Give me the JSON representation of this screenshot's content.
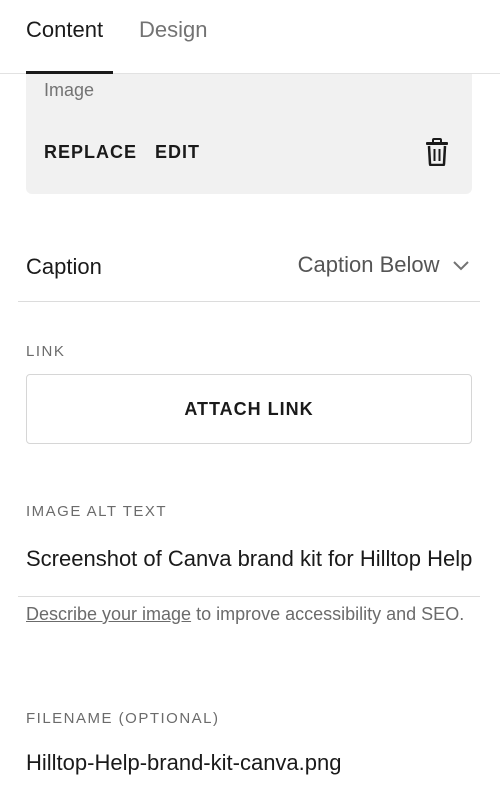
{
  "tabs": [
    {
      "label": "Content",
      "active": true
    },
    {
      "label": "Design",
      "active": false
    }
  ],
  "image_block": {
    "label": "Image",
    "replace_label": "REPLACE",
    "edit_label": "EDIT",
    "delete_icon": "trash-icon"
  },
  "caption": {
    "label": "Caption",
    "selected_value": "Caption Below",
    "icon": "chevron-down-icon"
  },
  "link": {
    "section_label": "LINK",
    "button_label": "ATTACH LINK"
  },
  "alt_text": {
    "section_label": "IMAGE ALT TEXT",
    "value": "Screenshot of Canva brand kit for Hilltop Help",
    "help_link": "Describe your image",
    "help_rest": " to improve accessibility and SEO."
  },
  "filename": {
    "section_label": "FILENAME (OPTIONAL)",
    "value": "Hilltop-Help-brand-kit-canva.png"
  },
  "colors": {
    "text": "#1a1a1a",
    "muted": "#737373",
    "card_bg": "#f1f1f1",
    "divider": "#dcdcdc"
  }
}
